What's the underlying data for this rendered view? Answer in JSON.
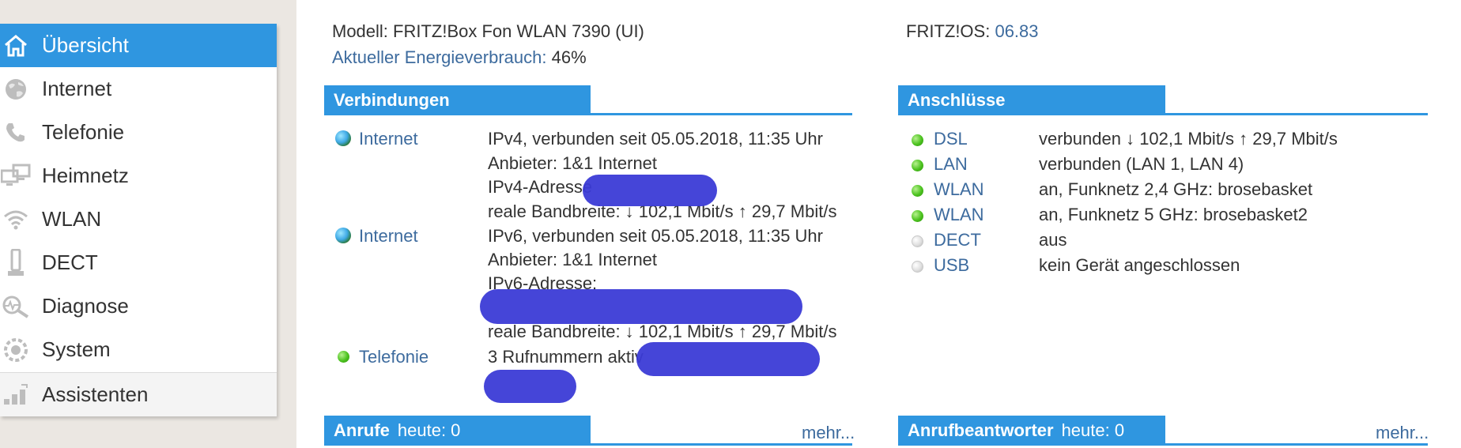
{
  "sidebar": {
    "items": [
      {
        "label": "Übersicht",
        "icon": "home-icon",
        "active": true
      },
      {
        "label": "Internet",
        "icon": "globe-icon"
      },
      {
        "label": "Telefonie",
        "icon": "phone-icon"
      },
      {
        "label": "Heimnetz",
        "icon": "network-icon"
      },
      {
        "label": "WLAN",
        "icon": "wifi-icon"
      },
      {
        "label": "DECT",
        "icon": "dect-phone-icon"
      },
      {
        "label": "Diagnose",
        "icon": "diagnose-icon"
      },
      {
        "label": "System",
        "icon": "system-icon"
      },
      {
        "label": "Assistenten",
        "icon": "assistant-icon"
      }
    ]
  },
  "header": {
    "model_label": "Modell: FRITZ!Box Fon WLAN 7390 (UI)",
    "energy_label": "Aktueller Energieverbrauch:",
    "energy_value": "46%",
    "os_label": "FRITZ!OS:",
    "os_value": "06.83"
  },
  "verbindungen": {
    "title": "Verbindungen",
    "rows": [
      {
        "name": "Internet",
        "lines": [
          "IPv4, verbunden seit 05.05.2018, 11:35 Uhr",
          "Anbieter: 1&1 Internet",
          "IPv4-Adresse",
          "reale Bandbreite: ↓ 102,1 Mbit/s ↑ 29,7 Mbit/s"
        ]
      },
      {
        "name": "Internet",
        "lines": [
          "IPv6, verbunden seit 05.05.2018, 11:35 Uhr",
          "Anbieter: 1&1 Internet",
          "IPv6-Adresse:",
          "reale Bandbreite: ↓ 102,1 Mbit/s ↑ 29,7 Mbit/s"
        ]
      },
      {
        "name": "Telefonie",
        "lines": [
          "3 Rufnummern aktiv"
        ]
      }
    ]
  },
  "anschluesse": {
    "title": "Anschlüsse",
    "rows": [
      {
        "name": "DSL",
        "status": "verbunden ↓ 102,1 Mbit/s ↑ 29,7 Mbit/s",
        "led": "green"
      },
      {
        "name": "LAN",
        "status": "verbunden (LAN 1, LAN 4)",
        "led": "green"
      },
      {
        "name": "WLAN",
        "status": "an, Funknetz 2,4 GHz: brosebasket",
        "led": "green"
      },
      {
        "name": "WLAN",
        "status": "an, Funknetz 5 GHz: brosebasket2",
        "led": "green"
      },
      {
        "name": "DECT",
        "status": "aus",
        "led": "gray"
      },
      {
        "name": "USB",
        "status": "kein Gerät angeschlossen",
        "led": "gray"
      }
    ]
  },
  "anrufe": {
    "title": "Anrufe",
    "sub": "heute: 0",
    "more": "mehr..."
  },
  "anrufbeantworter": {
    "title": "Anrufbeantworter",
    "sub": "heute: 0",
    "more": "mehr..."
  },
  "colors": {
    "accent": "#2f96e0",
    "link": "#3d6b9e",
    "led_on": "#4bc21e",
    "led_off": "#d9d9d9",
    "redaction": "#3b3bd6"
  }
}
